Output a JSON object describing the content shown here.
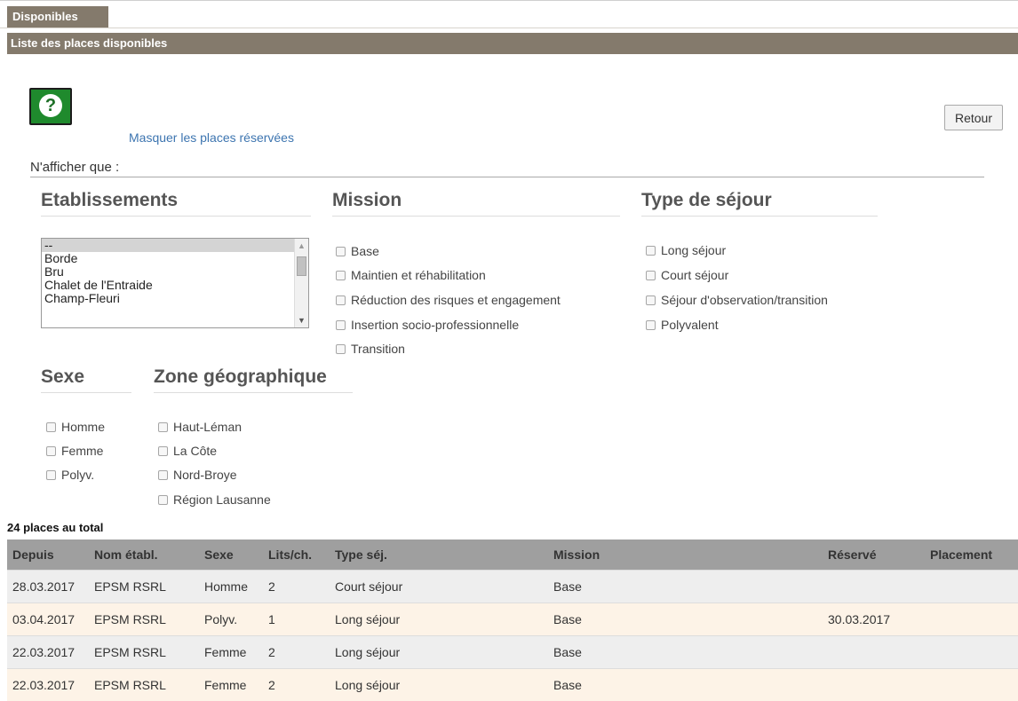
{
  "tab": {
    "label": "Disponibles"
  },
  "subheader": {
    "title": "Liste des places disponibles"
  },
  "help": {
    "glyph": "?"
  },
  "mask_link": "Masquer les places réservées",
  "retour_label": "Retour",
  "filter_label": "N'afficher que :",
  "sections": {
    "etablissements": "Etablissements",
    "mission": "Mission",
    "type_sejour": "Type de séjour",
    "sexe": "Sexe",
    "zone": "Zone géographique"
  },
  "etablissements_options": [
    "--",
    "Borde",
    "Bru",
    "Chalet de l'Entraide",
    "Champ-Fleuri"
  ],
  "mission_options": [
    "Base",
    "Maintien et réhabilitation",
    "Réduction des risques et engagement",
    "Insertion socio-professionnelle",
    "Transition"
  ],
  "type_sejour_options": [
    "Long séjour",
    "Court séjour",
    "Séjour d'observation/transition",
    "Polyvalent"
  ],
  "sexe_options": [
    "Homme",
    "Femme",
    "Polyv."
  ],
  "zone_options": [
    "Haut-Léman",
    "La Côte",
    "Nord-Broye",
    "Région Lausanne"
  ],
  "total": "24 places au total",
  "table": {
    "headers": [
      "Depuis",
      "Nom établ.",
      "Sexe",
      "Lits/ch.",
      "Type séj.",
      "Mission",
      "Réservé",
      "Placement"
    ],
    "rows": [
      [
        "28.03.2017",
        "EPSM RSRL",
        "Homme",
        "2",
        "Court séjour",
        "Base",
        "",
        ""
      ],
      [
        "03.04.2017",
        "EPSM RSRL",
        "Polyv.",
        "1",
        "Long séjour",
        "Base",
        "30.03.2017",
        ""
      ],
      [
        "22.03.2017",
        "EPSM RSRL",
        "Femme",
        "2",
        "Long séjour",
        "Base",
        "",
        ""
      ],
      [
        "22.03.2017",
        "EPSM RSRL",
        "Femme",
        "2",
        "Long séjour",
        "Base",
        "",
        ""
      ]
    ]
  },
  "colors": {
    "header_bar": "#847a6c",
    "table_header": "#9f9f9f",
    "link": "#3d75b0",
    "help_button": "#1f8a2d"
  }
}
